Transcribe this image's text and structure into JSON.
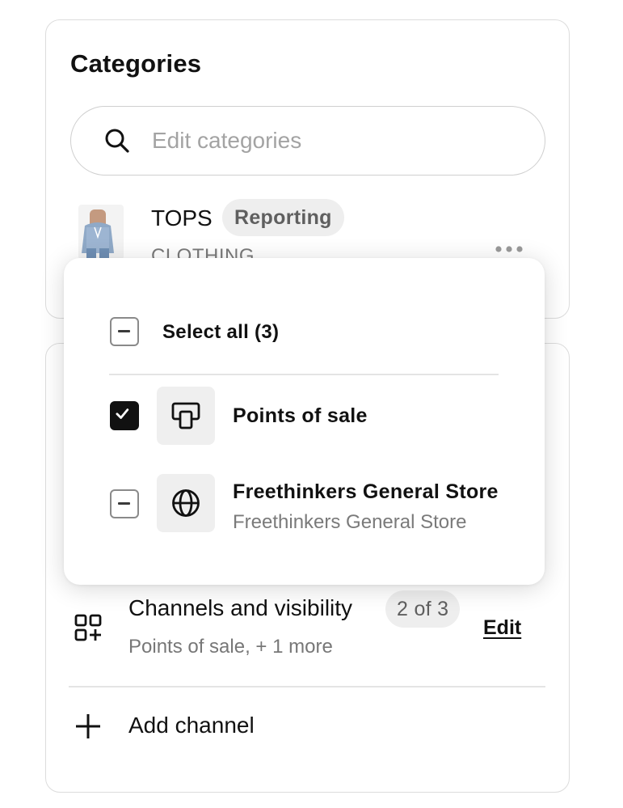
{
  "categories": {
    "title": "Categories",
    "search_placeholder": "Edit categories",
    "item": {
      "name": "TOPS",
      "badge": "Reporting",
      "subtitle": "CLOTHING"
    }
  },
  "channels": {
    "title": "Channels and visibility",
    "count_badge": "2 of 3",
    "summary": "Points of sale, + 1 more",
    "edit_label": "Edit",
    "add_label": "Add channel"
  },
  "popover": {
    "select_all_label": "Select all (3)",
    "options": [
      {
        "label": "Points of sale",
        "sublabel": "",
        "icon": "pos-terminal-icon",
        "state": "checked"
      },
      {
        "label": "Freethinkers General Store",
        "sublabel": "Freethinkers General Store",
        "icon": "globe-icon",
        "state": "indeterminate"
      }
    ]
  },
  "colors": {
    "badge_bg": "#eeeeee",
    "checkbox_checked": "#111111",
    "muted_text": "#7a7a7a"
  }
}
